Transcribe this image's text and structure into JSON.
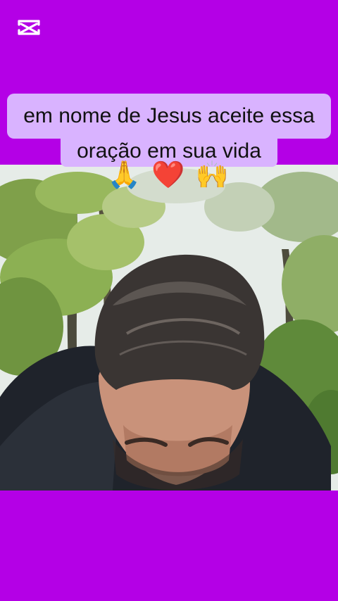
{
  "app": {
    "logo_icon": "capcut-logo-icon",
    "background": "#b400e6"
  },
  "caption": {
    "line1": "em nome de Jesus aceite essa",
    "line2": "oração em sua vida"
  },
  "emojis": [
    "🙏",
    "❤️",
    "🙌"
  ],
  "video": {
    "icon": "video-frame"
  }
}
